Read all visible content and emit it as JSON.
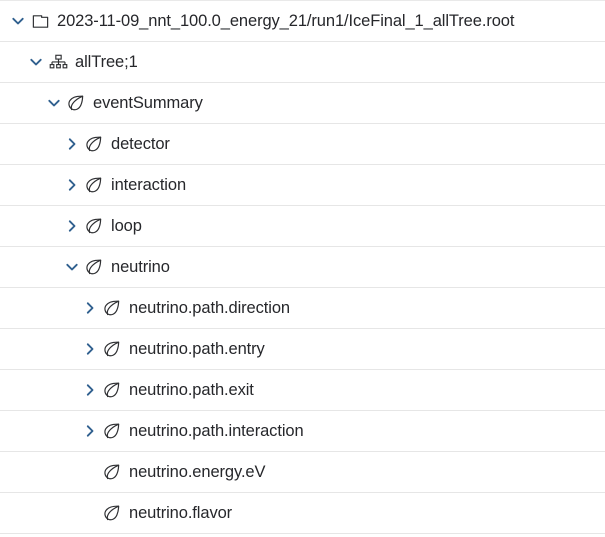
{
  "viewer": {
    "name": "root-file-tree-browser",
    "colors": {
      "chevron": "#30608f",
      "icon_stroke": "#2f3033",
      "text": "#26272b",
      "row_divider": "#e6e6e6",
      "background": "#ffffff"
    }
  },
  "tree": {
    "rows": [
      {
        "label": "2023-11-09_nnt_100.0_energy_21/run1/IceFinal_1_allTree.root",
        "depth": 0,
        "icon": "folder-icon",
        "twisty": "chevron-down-icon",
        "expanded": true
      },
      {
        "label": "allTree;1",
        "depth": 1,
        "icon": "sitemap-icon",
        "twisty": "chevron-down-icon",
        "expanded": true
      },
      {
        "label": "eventSummary",
        "depth": 2,
        "icon": "leaf-icon",
        "twisty": "chevron-down-icon",
        "expanded": true
      },
      {
        "label": "detector",
        "depth": 3,
        "icon": "leaf-icon",
        "twisty": "chevron-right-icon",
        "expanded": false
      },
      {
        "label": "interaction",
        "depth": 3,
        "icon": "leaf-icon",
        "twisty": "chevron-right-icon",
        "expanded": false
      },
      {
        "label": "loop",
        "depth": 3,
        "icon": "leaf-icon",
        "twisty": "chevron-right-icon",
        "expanded": false
      },
      {
        "label": "neutrino",
        "depth": 3,
        "icon": "leaf-icon",
        "twisty": "chevron-down-icon",
        "expanded": true
      },
      {
        "label": "neutrino.path.direction",
        "depth": 4,
        "icon": "leaf-icon",
        "twisty": "chevron-right-icon",
        "expanded": false
      },
      {
        "label": "neutrino.path.entry",
        "depth": 4,
        "icon": "leaf-icon",
        "twisty": "chevron-right-icon",
        "expanded": false
      },
      {
        "label": "neutrino.path.exit",
        "depth": 4,
        "icon": "leaf-icon",
        "twisty": "chevron-right-icon",
        "expanded": false
      },
      {
        "label": "neutrino.path.interaction",
        "depth": 4,
        "icon": "leaf-icon",
        "twisty": "chevron-right-icon",
        "expanded": false
      },
      {
        "label": "neutrino.energy.eV",
        "depth": 4,
        "icon": "leaf-icon",
        "twisty": "none",
        "expanded": false
      },
      {
        "label": "neutrino.flavor",
        "depth": 4,
        "icon": "leaf-icon",
        "twisty": "none",
        "expanded": false
      }
    ]
  }
}
